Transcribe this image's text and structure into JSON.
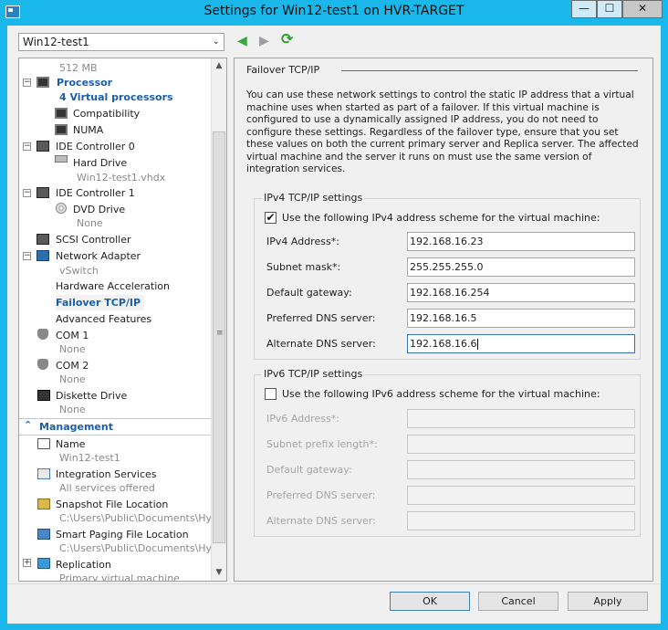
{
  "window": {
    "title": "Settings for Win12-test1 on HVR-TARGET",
    "min_glyph": "—",
    "max_glyph": "☐",
    "close_glyph": "✕"
  },
  "toolbar": {
    "vm_selected": "Win12-test1",
    "back_icon": "◀",
    "forward_icon": "▶",
    "refresh_icon": "⟳"
  },
  "tree": {
    "memory_sub": "512 MB",
    "processor": "Processor",
    "processor_sub": "4 Virtual processors",
    "compatibility": "Compatibility",
    "numa": "NUMA",
    "ide0": "IDE Controller 0",
    "hard_drive": "Hard Drive",
    "hard_drive_sub": "Win12-test1.vhdx",
    "ide1": "IDE Controller 1",
    "dvd_drive": "DVD Drive",
    "dvd_sub": "None",
    "scsi": "SCSI Controller",
    "network": "Network Adapter",
    "network_sub": "vSwitch",
    "hw_accel": "Hardware Acceleration",
    "failover": "Failover TCP/IP",
    "advanced": "Advanced Features",
    "com1": "COM 1",
    "com1_sub": "None",
    "com2": "COM 2",
    "com2_sub": "None",
    "diskette": "Diskette Drive",
    "diskette_sub": "None",
    "management": "Management",
    "name": "Name",
    "name_sub": "Win12-test1",
    "integration": "Integration Services",
    "integration_sub": "All services offered",
    "snapshot": "Snapshot File Location",
    "snapshot_sub": "C:\\Users\\Public\\Documents\\Hy...",
    "smart_paging": "Smart Paging File Location",
    "smart_paging_sub": "C:\\Users\\Public\\Documents\\Hy...",
    "replication": "Replication",
    "replication_sub": "Primary virtual machine",
    "expand_minus": "−",
    "expand_plus": "+",
    "collapse_arrow": "⌃"
  },
  "panel": {
    "heading": "Failover TCP/IP",
    "description": "You can use these network settings to control the static IP address that a virtual machine uses when started as part of a failover. If this virtual machine is configured to use a dynamically assigned IP address, you do not need to configure these settings. Regardless of the failover type, ensure that you set these values on both the current primary server and Replica server. The affected virtual machine and the server it runs on must use the same version of integration services.",
    "ipv4": {
      "title": "IPv4 TCP/IP settings",
      "checkbox_label": "Use the following IPv4 address scheme for the virtual machine:",
      "checked_glyph": "✔",
      "address_label": "IPv4 Address*:",
      "address_value": "192.168.16.23",
      "subnet_label": "Subnet mask*:",
      "subnet_value": "255.255.255.0",
      "gateway_label": "Default gateway:",
      "gateway_value": "192.168.16.254",
      "pref_dns_label": "Preferred DNS server:",
      "pref_dns_value": "192.168.16.5",
      "alt_dns_label": "Alternate DNS server:",
      "alt_dns_value": "192.168.16.6"
    },
    "ipv6": {
      "title": "IPv6 TCP/IP settings",
      "checkbox_label": "Use the following IPv6 address scheme for the virtual machine:",
      "address_label": "IPv6 Address*:",
      "prefix_label": "Subnet prefix length*:",
      "gateway_label": "Default gateway:",
      "pref_dns_label": "Preferred DNS server:",
      "alt_dns_label": "Alternate DNS server:"
    }
  },
  "buttons": {
    "ok": "OK",
    "cancel": "Cancel",
    "apply": "Apply"
  },
  "scroll": {
    "up": "▲",
    "down": "▼",
    "grip": "≡"
  }
}
